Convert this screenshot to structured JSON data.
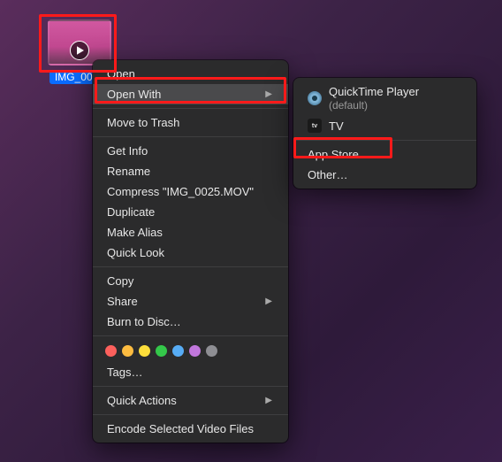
{
  "file": {
    "name": "IMG_0025"
  },
  "context_menu": {
    "open": "Open",
    "open_with": "Open With",
    "move_to_trash": "Move to Trash",
    "get_info": "Get Info",
    "rename": "Rename",
    "compress": "Compress \"IMG_0025.MOV\"",
    "duplicate": "Duplicate",
    "make_alias": "Make Alias",
    "quick_look": "Quick Look",
    "copy": "Copy",
    "share": "Share",
    "burn": "Burn to Disc…",
    "tags": "Tags…",
    "quick_actions": "Quick Actions",
    "encode": "Encode Selected Video Files"
  },
  "submenu": {
    "quicktime": "QuickTime Player",
    "default_suffix": " (default)",
    "tv": "TV",
    "app_store": "App Store…",
    "other": "Other…"
  },
  "tag_colors": [
    "#fc605c",
    "#fdbc40",
    "#fdde3b",
    "#34c84a",
    "#57acf5",
    "#c177dc",
    "#8e8e93"
  ]
}
